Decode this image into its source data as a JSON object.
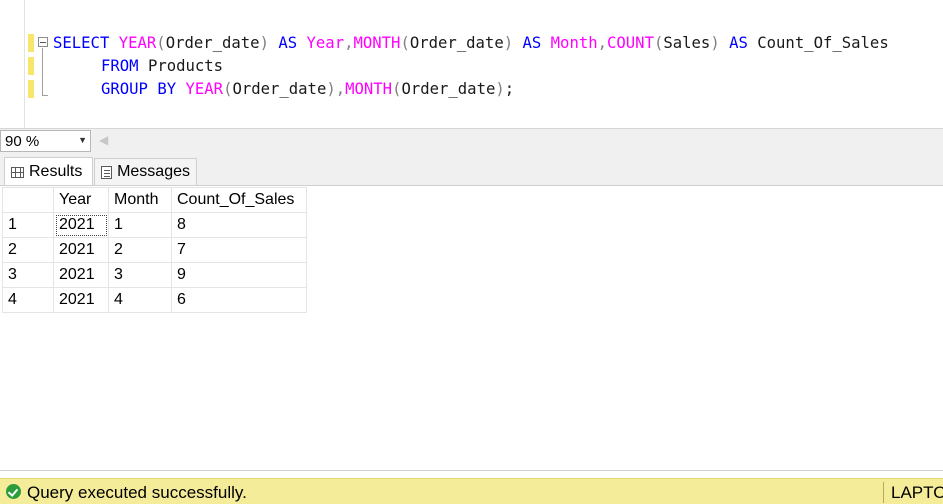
{
  "editor": {
    "line1": {
      "t1": "SELECT",
      "t2": " ",
      "t3": "YEAR",
      "t4": "(",
      "t5": "Order_date",
      "t6": ")",
      "t7": " ",
      "t8": "AS",
      "t9": " ",
      "t10": "Year",
      "t11": ",",
      "t12": "MONTH",
      "t13": "(",
      "t14": "Order_date",
      "t15": ")",
      "t16": " ",
      "t17": "AS",
      "t18": " ",
      "t19": "Month",
      "t20": ",",
      "t21": "COUNT",
      "t22": "(",
      "t23": "Sales",
      "t24": ")",
      "t25": " ",
      "t26": "AS",
      "t27": " ",
      "t28": "Count_Of_Sales"
    },
    "line2": {
      "t1": "FROM",
      "t2": " ",
      "t3": "Products"
    },
    "line3": {
      "t1": "GROUP BY",
      "t2": " ",
      "t3": "YEAR",
      "t4": "(",
      "t5": "Order_date",
      "t6": ")",
      "t7": ",",
      "t8": "MONTH",
      "t9": "(",
      "t10": "Order_date",
      "t11": ")",
      "t12": ";"
    }
  },
  "zoom": {
    "value": "90 %"
  },
  "tabs": {
    "results": "Results",
    "messages": "Messages"
  },
  "grid": {
    "columns": [
      "",
      "Year",
      "Month",
      "Count_Of_Sales"
    ],
    "rows": [
      [
        "1",
        "2021",
        "1",
        "8"
      ],
      [
        "2",
        "2021",
        "2",
        "7"
      ],
      [
        "3",
        "2021",
        "3",
        "9"
      ],
      [
        "4",
        "2021",
        "4",
        "6"
      ]
    ]
  },
  "status": {
    "message": "Query executed successfully.",
    "server": "LAPTO"
  },
  "colors": {
    "keyword": "#0000ff",
    "function": "#ff00ff",
    "status_bg": "#f5ec9a",
    "success": "#2c9c3c"
  }
}
